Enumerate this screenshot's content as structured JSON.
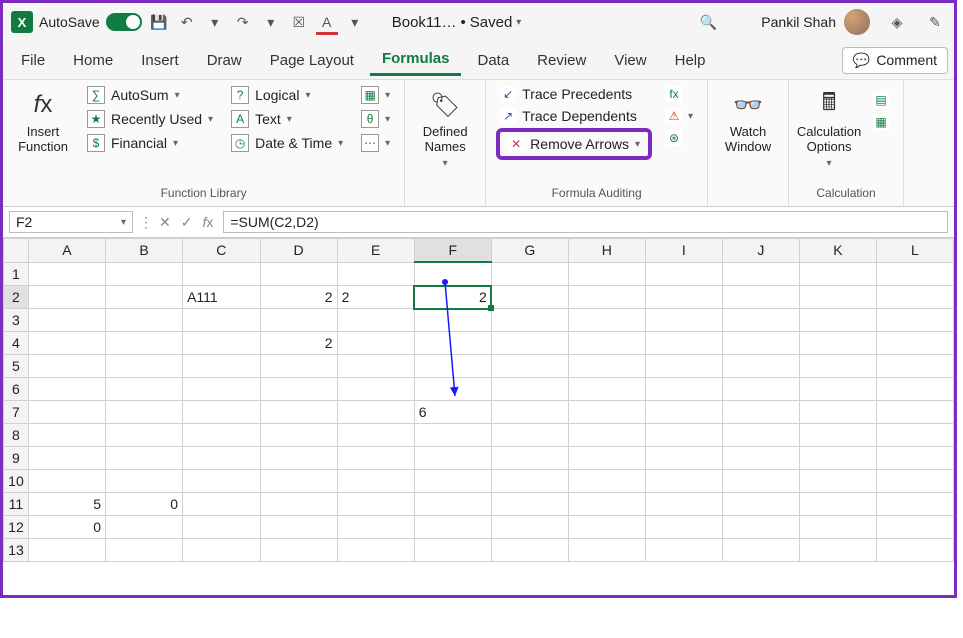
{
  "colors": {
    "accent": "#107c41",
    "highlight": "#7b2cbf"
  },
  "title": {
    "autosave": "AutoSave",
    "doc": "Book11…",
    "saved": "Saved",
    "user": "Pankil Shah"
  },
  "tabs": {
    "file": "File",
    "home": "Home",
    "insert": "Insert",
    "draw": "Draw",
    "page_layout": "Page Layout",
    "formulas": "Formulas",
    "data": "Data",
    "review": "Review",
    "view": "View",
    "help": "Help",
    "comment": "Comment"
  },
  "ribbon": {
    "insert_function": "Insert\nFunction",
    "autosum": "AutoSum",
    "recently_used": "Recently Used",
    "financial": "Financial",
    "logical": "Logical",
    "text": "Text",
    "date_time": "Date & Time",
    "defined_names": "Defined\nNames",
    "trace_precedents": "Trace Precedents",
    "trace_dependents": "Trace Dependents",
    "remove_arrows": "Remove Arrows",
    "watch_window": "Watch\nWindow",
    "calc_options": "Calculation\nOptions",
    "group_fn_lib": "Function Library",
    "group_formula_aud": "Formula Auditing",
    "group_calc": "Calculation"
  },
  "formula_bar": {
    "cell_ref": "F2",
    "formula": "=SUM(C2,D2)"
  },
  "cols": [
    "A",
    "B",
    "C",
    "D",
    "E",
    "F",
    "G",
    "H",
    "I",
    "J",
    "K",
    "L"
  ],
  "rows": [
    "1",
    "2",
    "3",
    "4",
    "5",
    "6",
    "7",
    "8",
    "9",
    "10",
    "11",
    "12",
    "13"
  ],
  "cells": {
    "C2": "A111",
    "D2": "2",
    "E2": "2",
    "F2": "2",
    "D4": "2",
    "F7": "6",
    "A11": "5",
    "B11": "0",
    "A12": "0"
  }
}
